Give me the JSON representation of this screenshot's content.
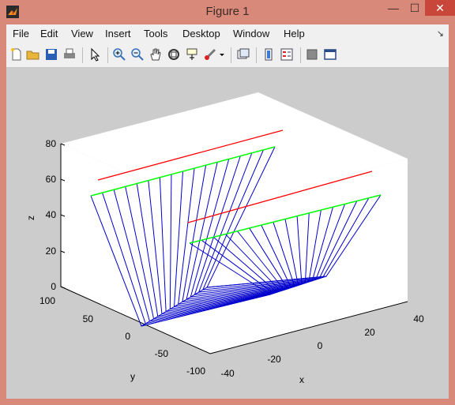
{
  "window": {
    "title": "Figure 1"
  },
  "menu": [
    "File",
    "Edit",
    "View",
    "Insert",
    "Tools",
    "Desktop",
    "Window",
    "Help"
  ],
  "toolbar_icons": [
    "new-figure-icon",
    "open-file-icon",
    "save-icon",
    "print-icon",
    "edit-plot-arrow-icon",
    "zoom-in-icon",
    "zoom-out-icon",
    "pan-hand-icon",
    "rotate-3d-icon",
    "data-cursor-icon",
    "brush-icon",
    "dropdown-arrow-icon",
    "link-plot-icon",
    "colorbar-icon",
    "legend-icon",
    "hide-plot-tools-icon",
    "show-plot-tools-icon"
  ],
  "axes": {
    "xlabel": "x",
    "ylabel": "y",
    "zlabel": "z",
    "x_ticks": [
      "-40",
      "-20",
      "0",
      "20",
      "40"
    ],
    "y_ticks": [
      "100",
      "50",
      "0",
      "-50",
      "-100"
    ],
    "z_ticks": [
      "0",
      "20",
      "40",
      "60",
      "80"
    ]
  },
  "colors": {
    "mesh": "#0000cc",
    "top_edge": "#00ff00",
    "top_line": "#ff0000",
    "background": "#cccccc",
    "axes_face": "#ffffff"
  }
}
